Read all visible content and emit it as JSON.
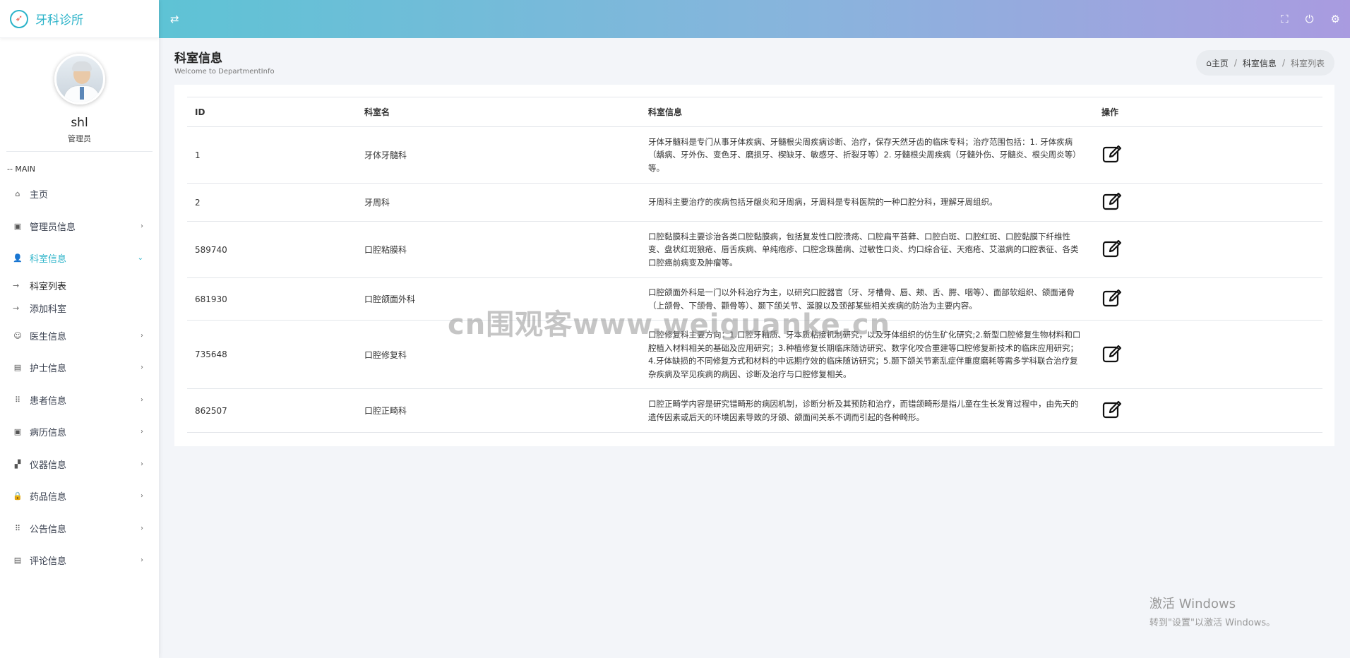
{
  "brand": {
    "title": "牙科诊所",
    "logo_icon": "compass-icon"
  },
  "profile": {
    "username": "shl",
    "role": "管理员"
  },
  "sidebar": {
    "section_label": "-- MAIN",
    "items": [
      {
        "label": "主页",
        "icon": "home-icon"
      },
      {
        "label": "管理员信息",
        "icon": "calendar-check-icon"
      },
      {
        "label": "科室信息",
        "icon": "user-plus-icon"
      },
      {
        "label": "医生信息",
        "icon": "user-icon"
      },
      {
        "label": "护士信息",
        "icon": "book-icon"
      },
      {
        "label": "患者信息",
        "icon": "grid-icon"
      },
      {
        "label": "病历信息",
        "icon": "calendar-check-icon"
      },
      {
        "label": "仪器信息",
        "icon": "blocks-icon"
      },
      {
        "label": "药品信息",
        "icon": "lock-icon"
      },
      {
        "label": "公告信息",
        "icon": "grid-icon"
      },
      {
        "label": "评论信息",
        "icon": "book-icon"
      }
    ],
    "subitems": [
      {
        "label": "科室列表"
      },
      {
        "label": "添加科室"
      }
    ]
  },
  "topbar": {
    "toggle_icon": "swap-icon",
    "icons": [
      "fullscreen-icon",
      "power-icon",
      "gear-icon"
    ]
  },
  "page": {
    "title": "科室信息",
    "subtitle": "Welcome to DepartmentInfo"
  },
  "breadcrumb": {
    "home": "主页",
    "section": "科室信息",
    "current": "科室列表",
    "sep": "/"
  },
  "table": {
    "headers": {
      "id": "ID",
      "name": "科室名",
      "info": "科室信息",
      "action": "操作"
    },
    "rows": [
      {
        "id": "1",
        "name": "牙体牙髓科",
        "info": "牙体牙髓科是专门从事牙体疾病、牙髓根尖周疾病诊断、治疗，保存天然牙齿的临床专科；治疗范围包括：1. 牙体疾病（龋病、牙外伤、变色牙、磨损牙、楔缺牙、敏感牙、折裂牙等）2. 牙髓根尖周疾病（牙髓外伤、牙髓炎、根尖周炎等）等。"
      },
      {
        "id": "2",
        "name": "牙周科",
        "info": "牙周科主要治疗的疾病包括牙龈炎和牙周病，牙周科是专科医院的一种口腔分科，理解牙周组织。"
      },
      {
        "id": "589740",
        "name": "口腔粘膜科",
        "info": "口腔黏膜科主要诊治各类口腔黏膜病，包括复发性口腔溃疡、口腔扁平苔藓、口腔白斑、口腔红斑、口腔黏膜下纤维性变、盘状红斑狼疮、唇舌疾病、单纯疱疹、口腔念珠菌病、过敏性口炎、灼口综合征、天疱疮、艾滋病的口腔表征、各类口腔癌前病变及肿瘤等。"
      },
      {
        "id": "681930",
        "name": "口腔颌面外科",
        "info": "口腔颌面外科是一门以外科治疗为主，以研究口腔器官（牙、牙槽骨、唇、颊、舌、腭、咽等）、面部软组织、颌面诸骨（上颌骨、下颌骨、颧骨等）、颞下颌关节、涎腺以及颈部某些相关疾病的防治为主要内容。"
      },
      {
        "id": "735648",
        "name": "口腔修复科",
        "info": "口腔修复科主要方向：1.口腔牙釉质、牙本质粘接机制研究，以及牙体组织的仿生矿化研究;2.新型口腔修复生物材料和口腔植入材料相关的基础及应用研究；3.种植修复长期临床随访研究、数字化咬合重建等口腔修复新技术的临床应用研究；4.牙体缺损的不同修复方式和材料的中远期疗效的临床随访研究；5.颞下颌关节紊乱症伴重度磨耗等需多学科联合治疗复杂疾病及罕见疾病的病因、诊断及治疗与口腔修复相关。"
      },
      {
        "id": "862507",
        "name": "口腔正畸科",
        "info": "口腔正畸学内容是研究错畸形的病因机制，诊断分析及其预防和治疗，而错颌畸形是指儿童在生长发育过程中，由先天的遗传因素或后天的环境因素导致的牙颌、颌面间关系不调而引起的各种畸形。"
      }
    ],
    "action_icon": "edit-icon"
  },
  "watermark": "cn围观客www.weiguanke.cn",
  "windows_notice": {
    "line1": "激活 Windows",
    "line2": "转到\"设置\"以激活 Windows。"
  }
}
